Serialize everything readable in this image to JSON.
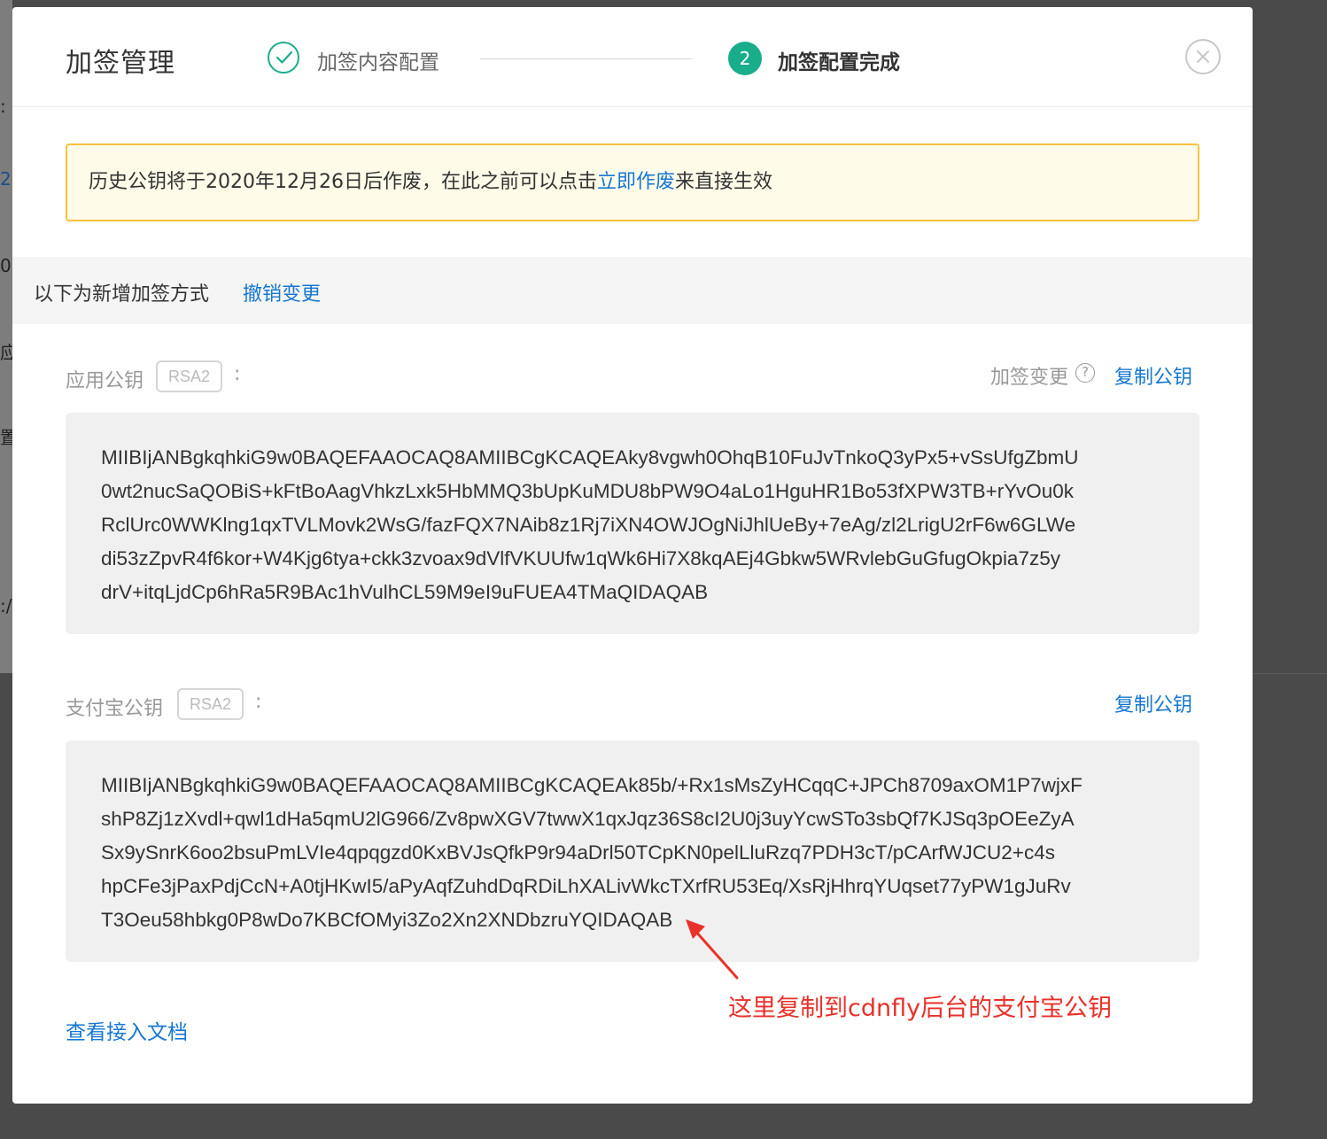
{
  "background": {
    "glyphs": [
      ":",
      "2.",
      "0",
      "应",
      "置",
      ":/"
    ]
  },
  "modal": {
    "title": "加签管理",
    "steps": [
      {
        "label": "加签内容配置",
        "state": "done",
        "icon": "check-icon"
      },
      {
        "number": "2",
        "label": "加签配置完成",
        "state": "active"
      }
    ],
    "close_icon": "close-circle-icon"
  },
  "notice": {
    "prefix": "历史公钥将于2020年12月26日后作废，在此之前可以点击",
    "link": "立即作废",
    "suffix": "来直接生效"
  },
  "section": {
    "text": "以下为新增加签方式",
    "link": "撤销变更"
  },
  "app_key": {
    "label": "应用公钥",
    "badge": "RSA2",
    "colon": ":",
    "change_label": "加签变更",
    "help_icon": "?",
    "copy_label": "复制公钥",
    "lines": [
      "MIIBIjANBgkqhkiG9w0BAQEFAAOCAQ8AMIIBCgKCAQEAky8vgwh0OhqB10FuJvTnkoQ3yPx5+vSsUfgZbmU",
      "0wt2nucSaQOBiS+kFtBoAagVhkzLxk5HbMMQ3bUpKuMDU8bPW9O4aLo1HguHR1Bo53fXPW3TB+rYvOu0k",
      "RclUrc0WWKlng1qxTVLMovk2WsG/fazFQX7NAib8z1Rj7iXN4OWJOgNiJhlUeBy+7eAg/zl2LrigU2rF6w6GLWe",
      "di53zZpvR4f6kor+W4Kjg6tya+ckk3zvoax9dVlfVKUUfw1qWk6Hi7X8kqAEj4Gbkw5WRvlebGuGfugOkpia7z5y",
      "drV+itqLjdCp6hRa5R9BAc1hVulhCL59M9eI9uFUEA4TMaQIDAQAB"
    ]
  },
  "alipay_key": {
    "label": "支付宝公钥",
    "badge": "RSA2",
    "colon": ":",
    "copy_label": "复制公钥",
    "lines": [
      "MIIBIjANBgkqhkiG9w0BAQEFAAOCAQ8AMIIBCgKCAQEAk85b/+Rx1sMsZyHCqqC+JPCh8709axOM1P7wjxF",
      "shP8Zj1zXvdl+qwl1dHa5qmU2lG966/Zv8pwXGV7twwX1qxJqz36S8cI2U0j3uyYcwSTo3sbQf7KJSq3pOEeZyA",
      "Sx9ySnrK6oo2bsuPmLVIe4qpqgzd0KxBVJsQfkP9r94aDrl50TCpKN0pelLluRzq7PDH3cT/pCArfWJCU2+c4s",
      "hpCFe3jPaxPdjCcN+A0tjHKwI5/aPyAqfZuhdDqRDiLhXALivWkcTXrfRU53Eq/XsRjHhrqYUqset77yPW1gJuRv",
      "T3Oeu58hbkg0P8wDo7KBCfOMyi3Zo2Xn2XNDbzruYQIDAQAB"
    ]
  },
  "doc_link": "查看接入文档",
  "annotation": {
    "text": "这里复制到cdnfly后台的支付宝公钥",
    "color": "#e8312a"
  },
  "colors": {
    "accent": "#1aad8c",
    "link": "#1677d2",
    "notice_border": "#f6c23e",
    "notice_bg": "#fffbe9"
  }
}
